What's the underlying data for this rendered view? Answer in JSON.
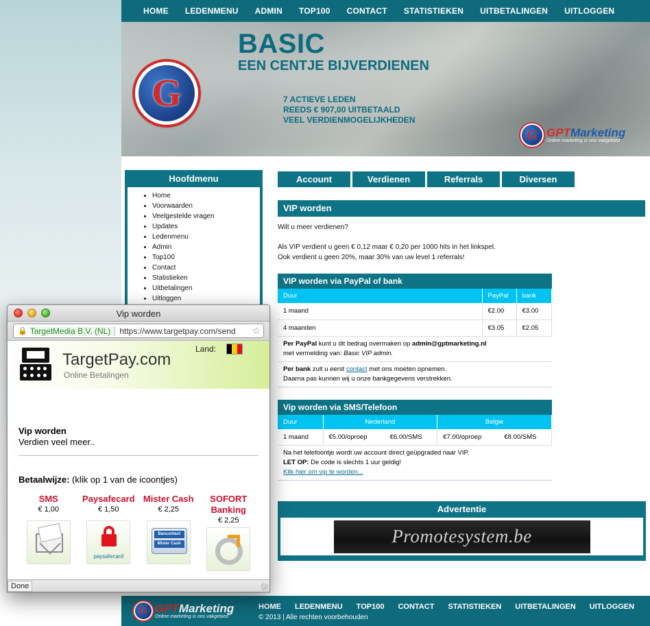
{
  "topnav": {
    "items": [
      "HOME",
      "LEDENMENU",
      "ADMIN",
      "TOP100",
      "CONTACT",
      "STATISTIEKEN",
      "UITBETALINGEN",
      "UITLOGGEN"
    ]
  },
  "banner": {
    "title": "BASIC",
    "subtitle": "EEN CENTJE BIJVERDIENEN",
    "stats": [
      "7 ACTIEVE LEDEN",
      "REEDS € 907,00 UITBETAALD",
      "VEEL VERDIENMOGELIJKHEDEN"
    ],
    "logo_letter": "G",
    "brand_gpt": "GPT",
    "brand_marketing": "Marketing",
    "brand_tagline": "Online marketing is ons vakgebied"
  },
  "sidebar": {
    "title": "Hoofdmenu",
    "items": [
      "Home",
      "Voorwaarden",
      "Veelgestelde vragen",
      "Updates",
      "Ledenmenu",
      "Admin",
      "Top100",
      "Contact",
      "Statistieken",
      "Uitbetalingen",
      "Uitloggen"
    ]
  },
  "tabs": [
    "Account",
    "Verdienen",
    "Referrals",
    "Diversen"
  ],
  "vip": {
    "heading": "VIP worden",
    "intro": "Wilt u meer verdienen?",
    "line1": "Als VIP verdient u geen € 0,12 maar € 0,20 per 1000 hits in het linkspel.",
    "line2": "Ook verdient u geen 20%, maar 30% van uw level 1 referrals!"
  },
  "paypal": {
    "heading": "VIP worden via PayPal of bank",
    "columns": [
      "Duur",
      "PayPal",
      "bank"
    ],
    "rows": [
      [
        "1 maand",
        "€2.00",
        "€3.00"
      ],
      [
        "4 maanden",
        "€3.05",
        "€2.05"
      ]
    ],
    "paypal_bold": "Per PayPal",
    "paypal_text": " kunt u dit bedrag overmaken op ",
    "paypal_email": "admin@gptmarketing.nl",
    "paypal_text2": "met vermelding van: ",
    "paypal_ref": "Basic VIP admin.",
    "bank_bold": "Per bank",
    "bank_text": " zult u eerst ",
    "bank_link": "contact",
    "bank_text2": " met ons moeten opnemen.",
    "bank_text3": "Daarna pas kunnen wij u onze bankgegevens verstrekken."
  },
  "sms": {
    "heading": "Vip worden via SMS/Telefoon",
    "columns": [
      "Duur",
      "Nederland",
      "Belgie"
    ],
    "row": [
      "1 maand",
      "€5.00/oproep",
      "€6.00/SMS",
      "€7.00/oproep",
      "€8.00/SMS"
    ],
    "note1": "Na het telefoontje wordt uw account direct geüpgraded naar VIP.",
    "note2_bold": "LET OP:",
    "note2": " De code is slechts 1 uur geldig!",
    "link": "Klik hier om vip te worden..."
  },
  "advert": {
    "title": "Advertentie",
    "banner_text": "Promotesystem.be"
  },
  "footer": {
    "nav": [
      "HOME",
      "LEDENMENU",
      "TOP100",
      "CONTACT",
      "STATISTIEKEN",
      "UITBETALINGEN",
      "UITLOGGEN"
    ],
    "copyright": "© 2013 | Alle rechten voorbehouden"
  },
  "popup": {
    "window_title": "Vip worden",
    "url_org": "TargetMedia B.V. (NL)",
    "url": "https://www.targetpay.com/send",
    "brand": "TargetPay.com",
    "brand_sub": "Online Betalingen",
    "land_label": "Land:",
    "flag_colors": [
      "#000000",
      "#f6d117",
      "#e0141e"
    ],
    "title": "Vip worden",
    "subtitle": "Verdien veel meer..",
    "pay_label": "Betaalwijze:",
    "pay_hint": " (klik op 1 van de icoontjes)",
    "methods": [
      {
        "name": "SMS",
        "price": "€ 1,00",
        "icon": "envelope-icon"
      },
      {
        "name": "Paysafecard",
        "price": "€ 1,50",
        "icon": "paysafecard-icon"
      },
      {
        "name": "Mister Cash",
        "price": "€ 2,25",
        "icon": "bancontact-icon"
      },
      {
        "name": "SOFORT Banking",
        "price": "€ 2,25",
        "icon": "sofort-icon"
      }
    ],
    "paysafe_text": "paysafecard",
    "bancontact_top": "Bancontact",
    "bancontact_bottom": "Mister Cash",
    "status": "Done"
  }
}
